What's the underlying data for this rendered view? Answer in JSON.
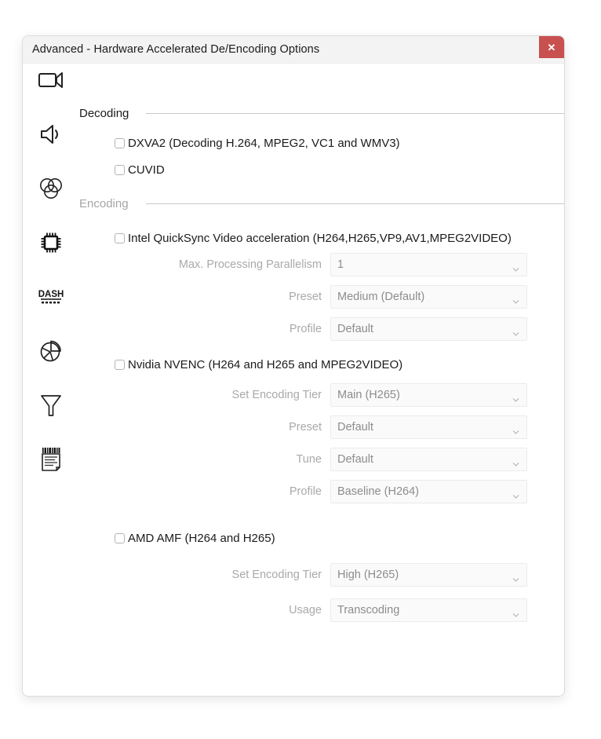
{
  "window": {
    "title": "Advanced - Hardware Accelerated De/Encoding Options",
    "close_label": "✕",
    "accent_close_color": "#c8504f"
  },
  "sidebar": {
    "items": [
      {
        "name": "video-icon",
        "icon": "video-camera"
      },
      {
        "name": "audio-icon",
        "icon": "speaker"
      },
      {
        "name": "color-icon",
        "icon": "color-circles"
      },
      {
        "name": "hardware-icon",
        "icon": "cpu-chip"
      },
      {
        "name": "dash-icon",
        "icon": "dash-text",
        "text": "DASH"
      },
      {
        "name": "statistics-icon",
        "icon": "pie-chart"
      },
      {
        "name": "filters-icon",
        "icon": "funnel"
      },
      {
        "name": "subtitles-icon",
        "icon": "document-lines"
      }
    ]
  },
  "sections": {
    "decoding": {
      "title": "Decoding",
      "disabled": false,
      "checkboxes": [
        {
          "label": "DXVA2 (Decoding H.264, MPEG2, VC1 and WMV3)",
          "checked": false
        },
        {
          "label": "CUVID",
          "checked": false
        }
      ]
    },
    "encoding": {
      "title": "Encoding",
      "disabled": true,
      "groups": [
        {
          "checkbox": {
            "label": "Intel QuickSync Video acceleration (H264,H265,VP9,AV1,MPEG2VIDEO)",
            "checked": false
          },
          "fields": [
            {
              "label": "Max. Processing Parallelism",
              "value": "1",
              "disabled": true
            },
            {
              "label": "Preset",
              "value": "Medium (Default)",
              "disabled": true
            },
            {
              "label": "Profile",
              "value": "Default",
              "disabled": true
            }
          ]
        },
        {
          "checkbox": {
            "label": "Nvidia NVENC (H264 and H265 and MPEG2VIDEO)",
            "checked": false
          },
          "fields": [
            {
              "label": "Set Encoding Tier",
              "value": "Main (H265)",
              "disabled": true
            },
            {
              "label": "Preset",
              "value": "Default",
              "disabled": true
            },
            {
              "label": "Tune",
              "value": "Default",
              "disabled": true
            },
            {
              "label": "Profile",
              "value": "Baseline (H264)",
              "disabled": true
            }
          ]
        },
        {
          "checkbox": {
            "label": "AMD AMF (H264 and H265)",
            "checked": false
          },
          "fields": [
            {
              "label": "Set Encoding Tier",
              "value": "High (H265)",
              "disabled": true
            },
            {
              "label": "Usage",
              "value": "Transcoding",
              "disabled": true
            }
          ]
        }
      ]
    }
  }
}
